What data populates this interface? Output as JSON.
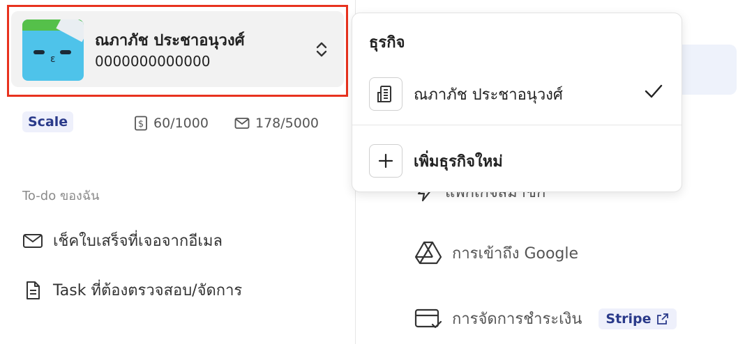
{
  "business_switcher": {
    "name": "ณภาภัช ประชาอนุวงศ์",
    "id_number": "0000000000000"
  },
  "plan": {
    "badge": "Scale",
    "receipts_usage": "60/1000",
    "emails_usage": "178/5000"
  },
  "todo": {
    "section_title": "To-do ของฉัน",
    "items": [
      {
        "label": "เช็คใบเสร็จที่เจอจากอีเมล",
        "icon": "mail-icon"
      },
      {
        "label": "Task ที่ต้องตรวจสอบ/จัดการ",
        "icon": "document-icon"
      }
    ]
  },
  "settings_nav": {
    "items": [
      {
        "label": "แพ็กเกจสมาชิก",
        "icon": "lightning-icon"
      },
      {
        "label": "การเข้าถึง Google",
        "icon": "google-drive-icon"
      },
      {
        "label": "การจัดการชำระเงิน",
        "icon": "credit-card-icon",
        "badge": "Stripe"
      }
    ]
  },
  "dropdown": {
    "title": "ธุรกิจ",
    "businesses": [
      {
        "name": "ณภาภัช ประชาอนุวงศ์",
        "selected": true,
        "icon": "building-icon"
      }
    ],
    "add_label": "เพิ่มธุรกิจใหม่"
  },
  "colors": {
    "highlight": "#e8321e",
    "badge_bg": "#eef0fb",
    "badge_text": "#2a3a8a",
    "avatar_bg": "#4ec3ea"
  }
}
